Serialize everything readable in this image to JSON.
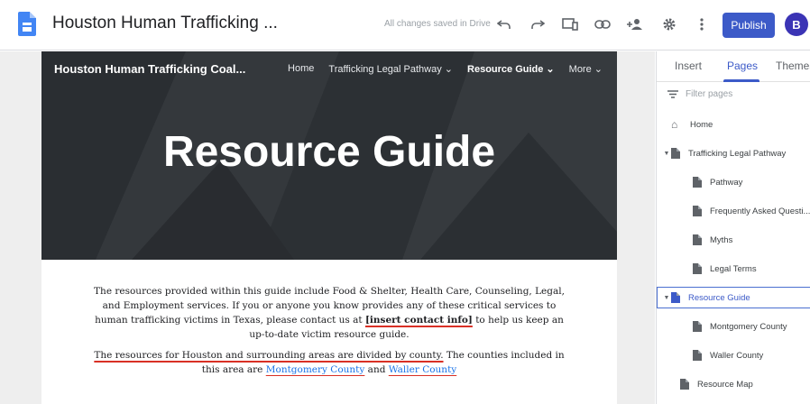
{
  "topbar": {
    "doc_title": "Houston Human Trafficking ...",
    "saved_status": "All changes saved in Drive",
    "publish_label": "Publish",
    "avatar_initial": "B"
  },
  "site": {
    "title": "Houston Human Trafficking Coal...",
    "nav": [
      {
        "label": "Home"
      },
      {
        "label": "Trafficking Legal Pathway ⌄"
      },
      {
        "label": "Resource Guide ⌄"
      },
      {
        "label": "More ⌄"
      }
    ],
    "hero_title": "Resource Guide",
    "paragraph1_a": "The resources provided within this guide include Food & Shelter, Health Care, Counseling, Legal, and Employment services. If you or anyone you know provides any of these critical services to human trafficking victims in Texas, please contact us at ",
    "paragraph1_link": "[insert contact info]",
    "paragraph1_b": " to help us keep an up-to-date victim resource guide.",
    "paragraph2_a": "The resources for Houston and surrounding areas are divided by county.",
    "paragraph2_b": " The counties included in this area are ",
    "county1": "Montgomery County",
    "and_text": " and ",
    "county2": "Waller County"
  },
  "panel": {
    "tabs": [
      {
        "label": "Insert"
      },
      {
        "label": "Pages"
      },
      {
        "label": "Themes"
      }
    ],
    "filter_placeholder": "Filter pages",
    "pages": [
      {
        "label": "Home"
      },
      {
        "label": "Trafficking Legal Pathway"
      },
      {
        "label": "Pathway"
      },
      {
        "label": "Frequently Asked Questi..."
      },
      {
        "label": "Myths"
      },
      {
        "label": "Legal Terms"
      },
      {
        "label": "Resource Guide"
      },
      {
        "label": "Montgomery County"
      },
      {
        "label": "Waller County"
      },
      {
        "label": "Resource Map"
      }
    ]
  },
  "colors": {
    "accent": "#3c5ac8",
    "hero_bg": "#2f3337",
    "link": "#1a73e8",
    "spell_underline": "#d93025"
  },
  "icons": [
    "sites-logo-icon",
    "undo-icon",
    "redo-icon",
    "preview-icon",
    "link-icon",
    "share-icon",
    "settings-gear-icon",
    "more-vert-icon",
    "filter-icon",
    "home-icon",
    "page-icon",
    "caret-down-icon"
  ]
}
